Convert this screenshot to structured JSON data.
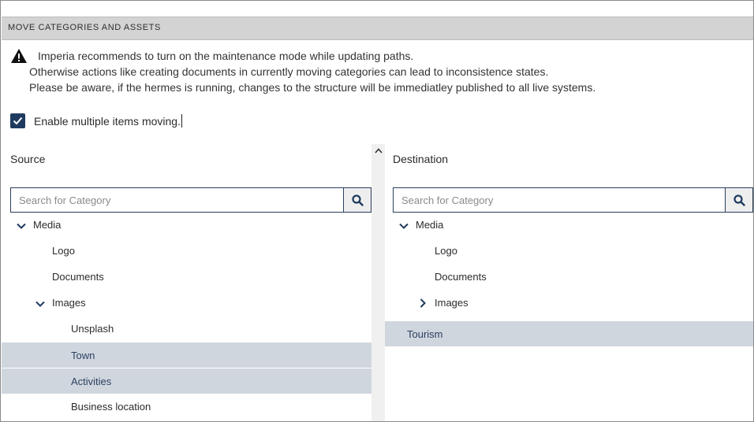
{
  "header": {
    "title": "MOVE CATEGORIES AND ASSETS"
  },
  "warning": {
    "icon": "warning-triangle-icon",
    "line1": "Imperia recommends to turn on the maintenance mode while updating paths.",
    "line2": "Otherwise actions like creating documents in currently moving categories can lead to inconsistence states.",
    "line3": "Please be aware, if the hermes is running, changes to the structure will be immediatley published to all live systems."
  },
  "multi_move": {
    "label": "Enable multiple items moving.",
    "checked": true
  },
  "source": {
    "label": "Source",
    "search_placeholder": "Search for Category",
    "tree": [
      {
        "label": "Media",
        "expanded": true,
        "selected": false
      },
      {
        "label": "Logo",
        "selected": false
      },
      {
        "label": "Documents",
        "selected": false
      },
      {
        "label": "Images",
        "expanded": true,
        "selected": false
      },
      {
        "label": "Unsplash",
        "selected": false
      },
      {
        "label": "Town",
        "selected": true
      },
      {
        "label": "Activities",
        "selected": true
      },
      {
        "label": "Business location",
        "selected": false
      }
    ]
  },
  "destination": {
    "label": "Destination",
    "search_placeholder": "Search for Category",
    "tree": [
      {
        "label": "Media",
        "expanded": true,
        "selected": false
      },
      {
        "label": "Logo",
        "selected": false
      },
      {
        "label": "Documents",
        "selected": false
      },
      {
        "label": "Images",
        "expanded": false,
        "selected": false
      },
      {
        "label": "Tourism",
        "selected": true
      }
    ]
  },
  "colors": {
    "accent": "#1f3a5f",
    "selected_row": "#d0d6de",
    "header_bg": "#d3d3d3"
  }
}
